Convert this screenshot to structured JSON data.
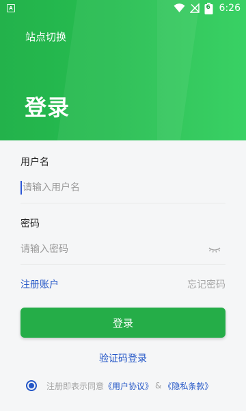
{
  "status_bar": {
    "time": "6:26",
    "battery_level": "6",
    "left_icon_letter": "A"
  },
  "header": {
    "site_switch": "站点切换",
    "title": "登录"
  },
  "form": {
    "username_label": "用户名",
    "username_placeholder": "请输入用户名",
    "password_label": "密码",
    "password_placeholder": "请输入密码",
    "register_link": "注册账户",
    "forgot_link": "忘记密码",
    "login_button": "登录",
    "code_login": "验证码登录"
  },
  "agreement": {
    "prefix": "注册即表示同意",
    "user_agreement": "《用户协议》",
    "amp": "&",
    "privacy_policy": "《隐私条款》",
    "checked": true
  },
  "colors": {
    "header_green": "#26bd50",
    "button_green": "#25ad48",
    "link_blue": "#2356c7"
  },
  "icons": {
    "password_visibility": "eye-closed-icon",
    "wifi": "wifi-icon",
    "signal": "no-signal-icon",
    "battery": "battery-icon"
  }
}
